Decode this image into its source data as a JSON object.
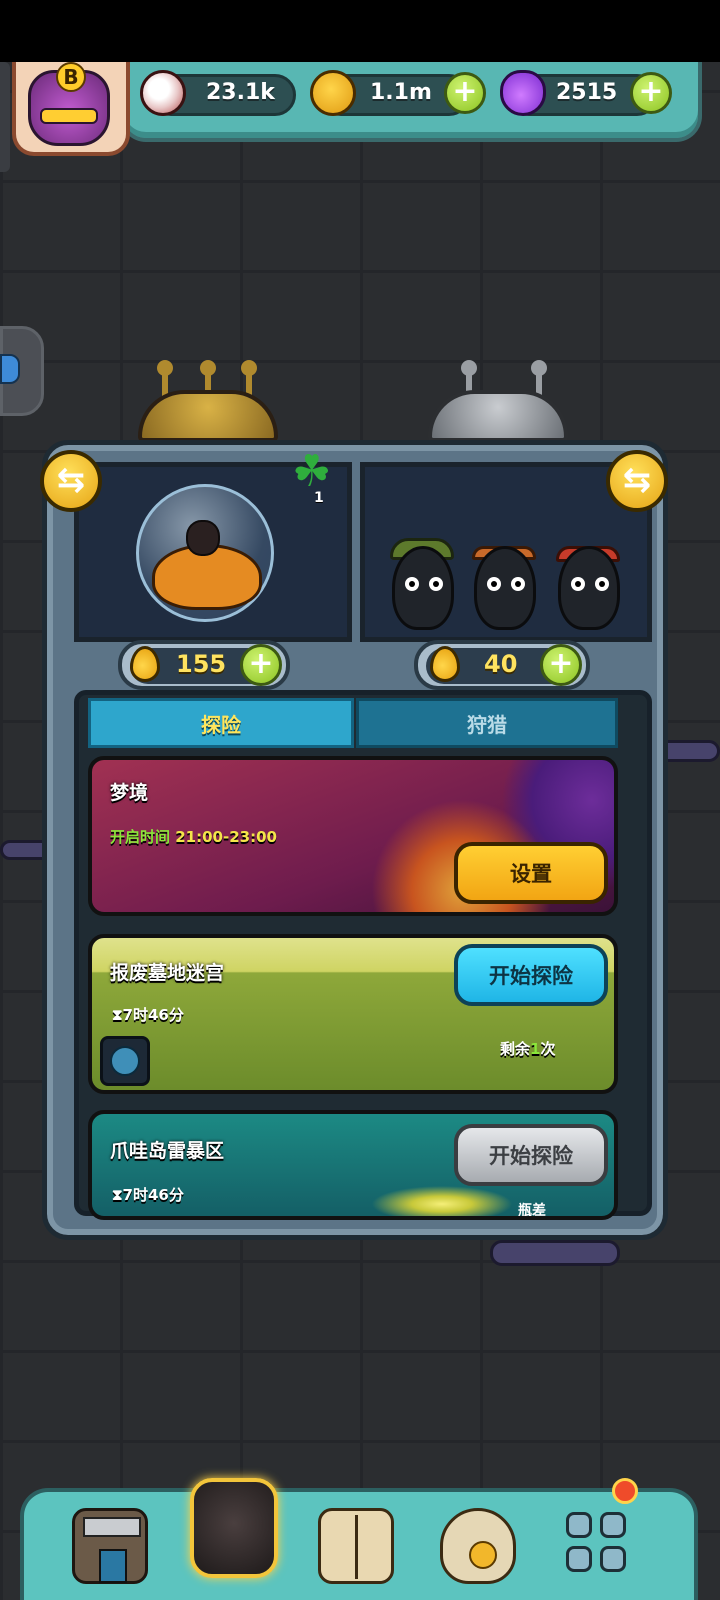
{
  "header": {
    "rank_letter": "B",
    "resources": {
      "eyeball": {
        "icon": "eyeball-icon",
        "value": "23.1k"
      },
      "coin": {
        "icon": "coin-icon",
        "value": "1.1m"
      },
      "potion": {
        "icon": "potion-icon",
        "value": "2515"
      }
    }
  },
  "machine": {
    "clover_count": "1",
    "left_counter": "155",
    "right_counter": "40"
  },
  "tabs": [
    {
      "label": "探险",
      "active": true
    },
    {
      "label": "狩猎",
      "active": false
    }
  ],
  "cards": {
    "dream": {
      "title": "梦境",
      "open_time_label": "开启时间",
      "open_time": "21:00-23:00",
      "button": "设置"
    },
    "scrap": {
      "title": "报废墓地迷宫",
      "timer": "7时46分",
      "button": "开始探险",
      "remaining_prefix": "剩余",
      "remaining_count": "1",
      "remaining_suffix": "次"
    },
    "storm": {
      "title": "爪哇岛雷暴区",
      "timer": "7时46分",
      "button": "开始探险",
      "cut_text": "瓶差"
    }
  },
  "colors": {
    "accent_teal": "#58b7b3",
    "tab_active": "#2ea6cc",
    "button_yellow": "#ffcf33",
    "button_blue": "#4fe0ff",
    "green_text": "#8be63a"
  },
  "bottom_nav": [
    {
      "icon": "shop-building-icon"
    },
    {
      "icon": "monster-home-icon",
      "selected": true
    },
    {
      "icon": "book-icon"
    },
    {
      "icon": "money-bag-icon"
    },
    {
      "icon": "grid-menu-icon",
      "badge": true
    }
  ]
}
